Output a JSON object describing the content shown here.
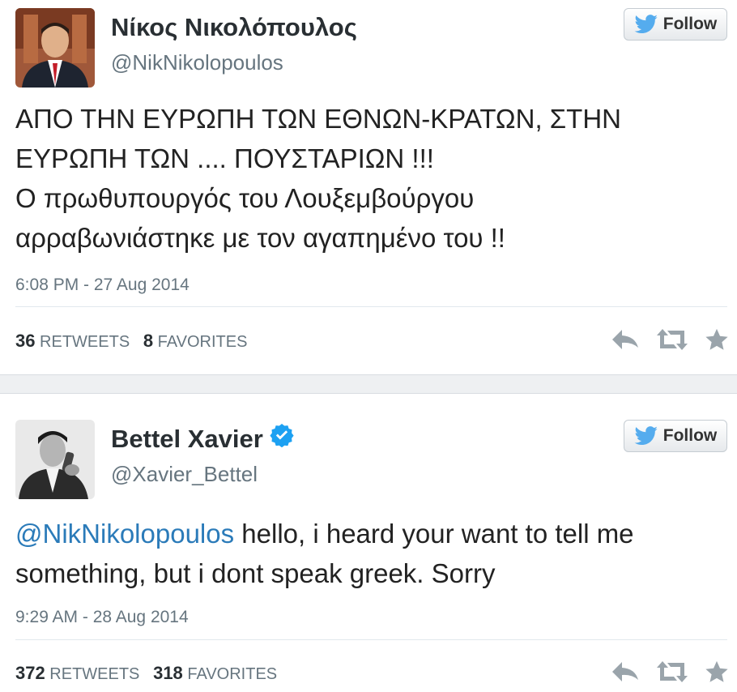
{
  "tweets": [
    {
      "name": "Νίκος Νικολόπουλος",
      "handle": "@NikNikolopoulos",
      "follow_label": "Follow",
      "verified": false,
      "text_lines": [
        "ΑΠΟ ΤΗΝ ΕΥΡΩΠΗ ΤΩΝ ΕΘΝΩΝ-ΚΡΑΤΩΝ, ΣΤΗΝ",
        "ΕΥΡΩΠΗ ΤΩΝ .... ΠΟΥΣΤΑΡΙΩΝ !!!",
        "Ο πρωθυπουργός του Λουξεμβούργου",
        "αρραβωνιάστηκε με τον αγαπημένο του !!"
      ],
      "timestamp": "6:08 PM - 27 Aug 2014",
      "retweets_count": "36",
      "retweets_label": "RETWEETS",
      "favorites_count": "8",
      "favorites_label": "FAVORITES"
    },
    {
      "name": "Bettel Xavier",
      "handle": "@Xavier_Bettel",
      "follow_label": "Follow",
      "verified": true,
      "mention": "@NikNikolopoulos",
      "text_line1_rest": " hello, i heard your want to tell me",
      "text_line2": "something, but i dont speak greek. Sorry",
      "timestamp": "9:29 AM - 28 Aug 2014",
      "retweets_count": "372",
      "retweets_label": "RETWEETS",
      "favorites_count": "318",
      "favorites_label": "FAVORITES"
    }
  ],
  "colors": {
    "twitter_blue": "#55acee",
    "mention": "#2b7bb9",
    "verified": "#1da1f2",
    "muted": "#66757f",
    "icon": "#9aa4ab"
  },
  "icons": [
    "twitter-bird-icon",
    "verified-badge-icon",
    "reply-icon",
    "retweet-icon",
    "favorite-star-icon"
  ]
}
